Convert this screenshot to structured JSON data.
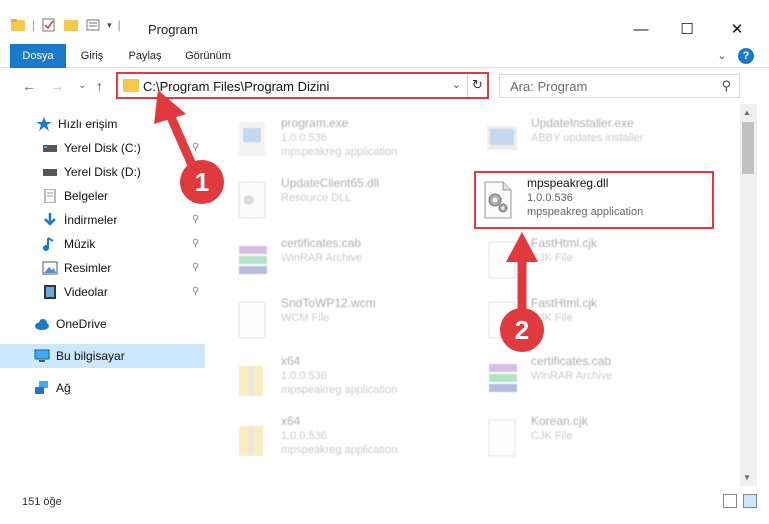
{
  "window": {
    "title": "Program",
    "minimize": "—",
    "maximize": "☐",
    "close": "✕"
  },
  "ribbon": {
    "tabs": [
      "Dosya",
      "Giriş",
      "Paylaş",
      "Görünüm"
    ],
    "expand": "⌄",
    "help": "?"
  },
  "address": {
    "back": "←",
    "forward": "→",
    "recent": "⌄",
    "up": "↑",
    "path": "C:\\Program Files\\Program Dizini",
    "dropdown": "⌄",
    "refresh": "↻"
  },
  "search": {
    "placeholder": "Ara: Program",
    "icon": "⚲"
  },
  "sidebar": {
    "items": [
      {
        "label": "Hızlı erişim",
        "icon": "star-icon",
        "pinned": false
      },
      {
        "label": "Yerel Disk (C:)",
        "icon": "drive-icon",
        "pinned": true
      },
      {
        "label": "Yerel Disk (D:)",
        "icon": "drive-icon",
        "pinned": true
      },
      {
        "label": "Belgeler",
        "icon": "document-icon",
        "pinned": true
      },
      {
        "label": "İndirmeler",
        "icon": "download-icon",
        "pinned": true
      },
      {
        "label": "Müzik",
        "icon": "music-icon",
        "pinned": true
      },
      {
        "label": "Resimler",
        "icon": "picture-icon",
        "pinned": true
      },
      {
        "label": "Videolar",
        "icon": "video-icon",
        "pinned": true
      },
      {
        "label": "OneDrive",
        "icon": "cloud-icon",
        "pinned": false
      },
      {
        "label": "Bu bilgisayar",
        "icon": "computer-icon",
        "pinned": false,
        "selected": true
      },
      {
        "label": "Ağ",
        "icon": "network-icon",
        "pinned": false
      }
    ]
  },
  "files": [
    {
      "name": "program.exe",
      "line2": "1.0.0.536",
      "line3": "mpspeakreg application",
      "icon": "exe-icon"
    },
    {
      "name": "UpdateInstaller.exe",
      "line2": "ABBY updates installer",
      "line3": "",
      "icon": "exe-icon"
    },
    {
      "name": "UpdateClient65.dll",
      "line2": "Resource DLL",
      "line3": "",
      "icon": "dll-icon"
    },
    {
      "name": "mpspeakreg.dll",
      "line2": "1.0.0.536",
      "line3": "mpspeakreg application",
      "icon": "dll-gear-icon"
    },
    {
      "name": "certificates.cab",
      "line2": "WinRAR Archive",
      "line3": "",
      "icon": "archive-icon"
    },
    {
      "name": "FastHtml.cjk",
      "line2": "CJK File",
      "line3": "",
      "icon": "blank-file-icon"
    },
    {
      "name": "SndToWP12.wcm",
      "line2": "WCM File",
      "line3": "",
      "icon": "blank-file-icon"
    },
    {
      "name": "FastHtml.cjk",
      "line2": "CJK File",
      "line3": "",
      "icon": "blank-file-icon"
    },
    {
      "name": "x64",
      "line2": "1.0.0.536",
      "line3": "mpspeakreg application",
      "icon": "folder-zip-icon"
    },
    {
      "name": "certificates.cab",
      "line2": "WinRAR Archive",
      "line3": "",
      "icon": "archive-icon"
    },
    {
      "name": "x64",
      "line2": "1.0.0.536",
      "line3": "mpspeakreg application",
      "icon": "folder-zip-icon"
    },
    {
      "name": "Korean.cjk",
      "line2": "CJK File",
      "line3": "",
      "icon": "blank-file-icon"
    }
  ],
  "annotations": {
    "step1": "1",
    "step2": "2"
  },
  "status": {
    "count": "151 öğe"
  },
  "colors": {
    "accent": "#1979ca",
    "highlight": "#e0393e",
    "selected": "#cce8ff"
  }
}
